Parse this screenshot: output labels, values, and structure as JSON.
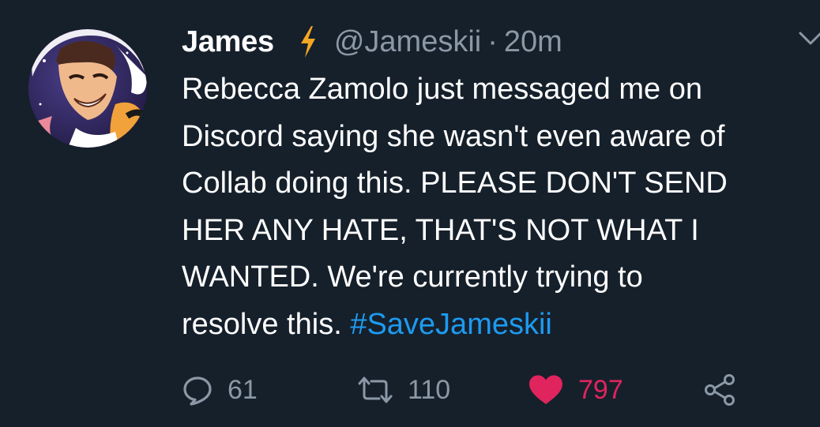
{
  "tweet": {
    "author_name": "James",
    "handle": "@Jameskii",
    "separator": "·",
    "time": "20m",
    "body_lines": [
      "Rebecca Zamolo just messaged me on",
      "Discord saying she wasn't even aware of",
      "Collab doing this. PLEASE DON'T SEND",
      "HER ANY HATE, THAT'S NOT WHAT I",
      "WANTED. We're currently trying to"
    ],
    "last_line_text": "resolve this. ",
    "hashtag": "#SaveJameskii",
    "counts": {
      "replies": "61",
      "retweets": "110",
      "likes": "797"
    },
    "liked": true
  },
  "icons": {
    "badge": "lightning-bolt-icon",
    "menu": "chevron-down-icon",
    "reply": "reply-bubble-icon",
    "retweet": "retweet-icon",
    "like": "heart-icon",
    "share": "share-icon"
  },
  "colors": {
    "background": "#16202b",
    "text": "#ffffff",
    "muted": "#8b98a5",
    "link": "#1d9bf0",
    "like": "#e0245e",
    "bolt": "#f5a623"
  }
}
